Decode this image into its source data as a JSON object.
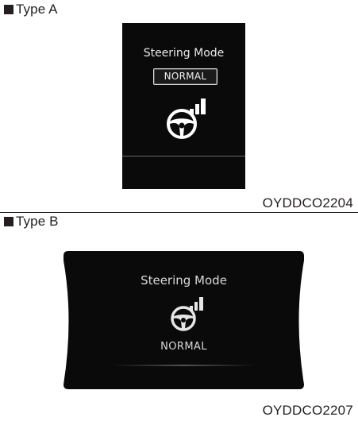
{
  "type_a": {
    "heading": "Type A",
    "display_title": "Steering Mode",
    "mode_label": "NORMAL",
    "wheel_icon": "steering-wheel-icon",
    "image_code": "OYDDCO2204"
  },
  "type_b": {
    "heading": "Type B",
    "display_title": "Steering Mode",
    "mode_label": "NORMAL",
    "wheel_icon": "steering-wheel-icon",
    "image_code": "OYDDCO2207"
  },
  "colors": {
    "text": "#231f20",
    "display_background": "#0a0a0a",
    "display_text": "#e8e8e8",
    "bullet": "#231f20"
  }
}
